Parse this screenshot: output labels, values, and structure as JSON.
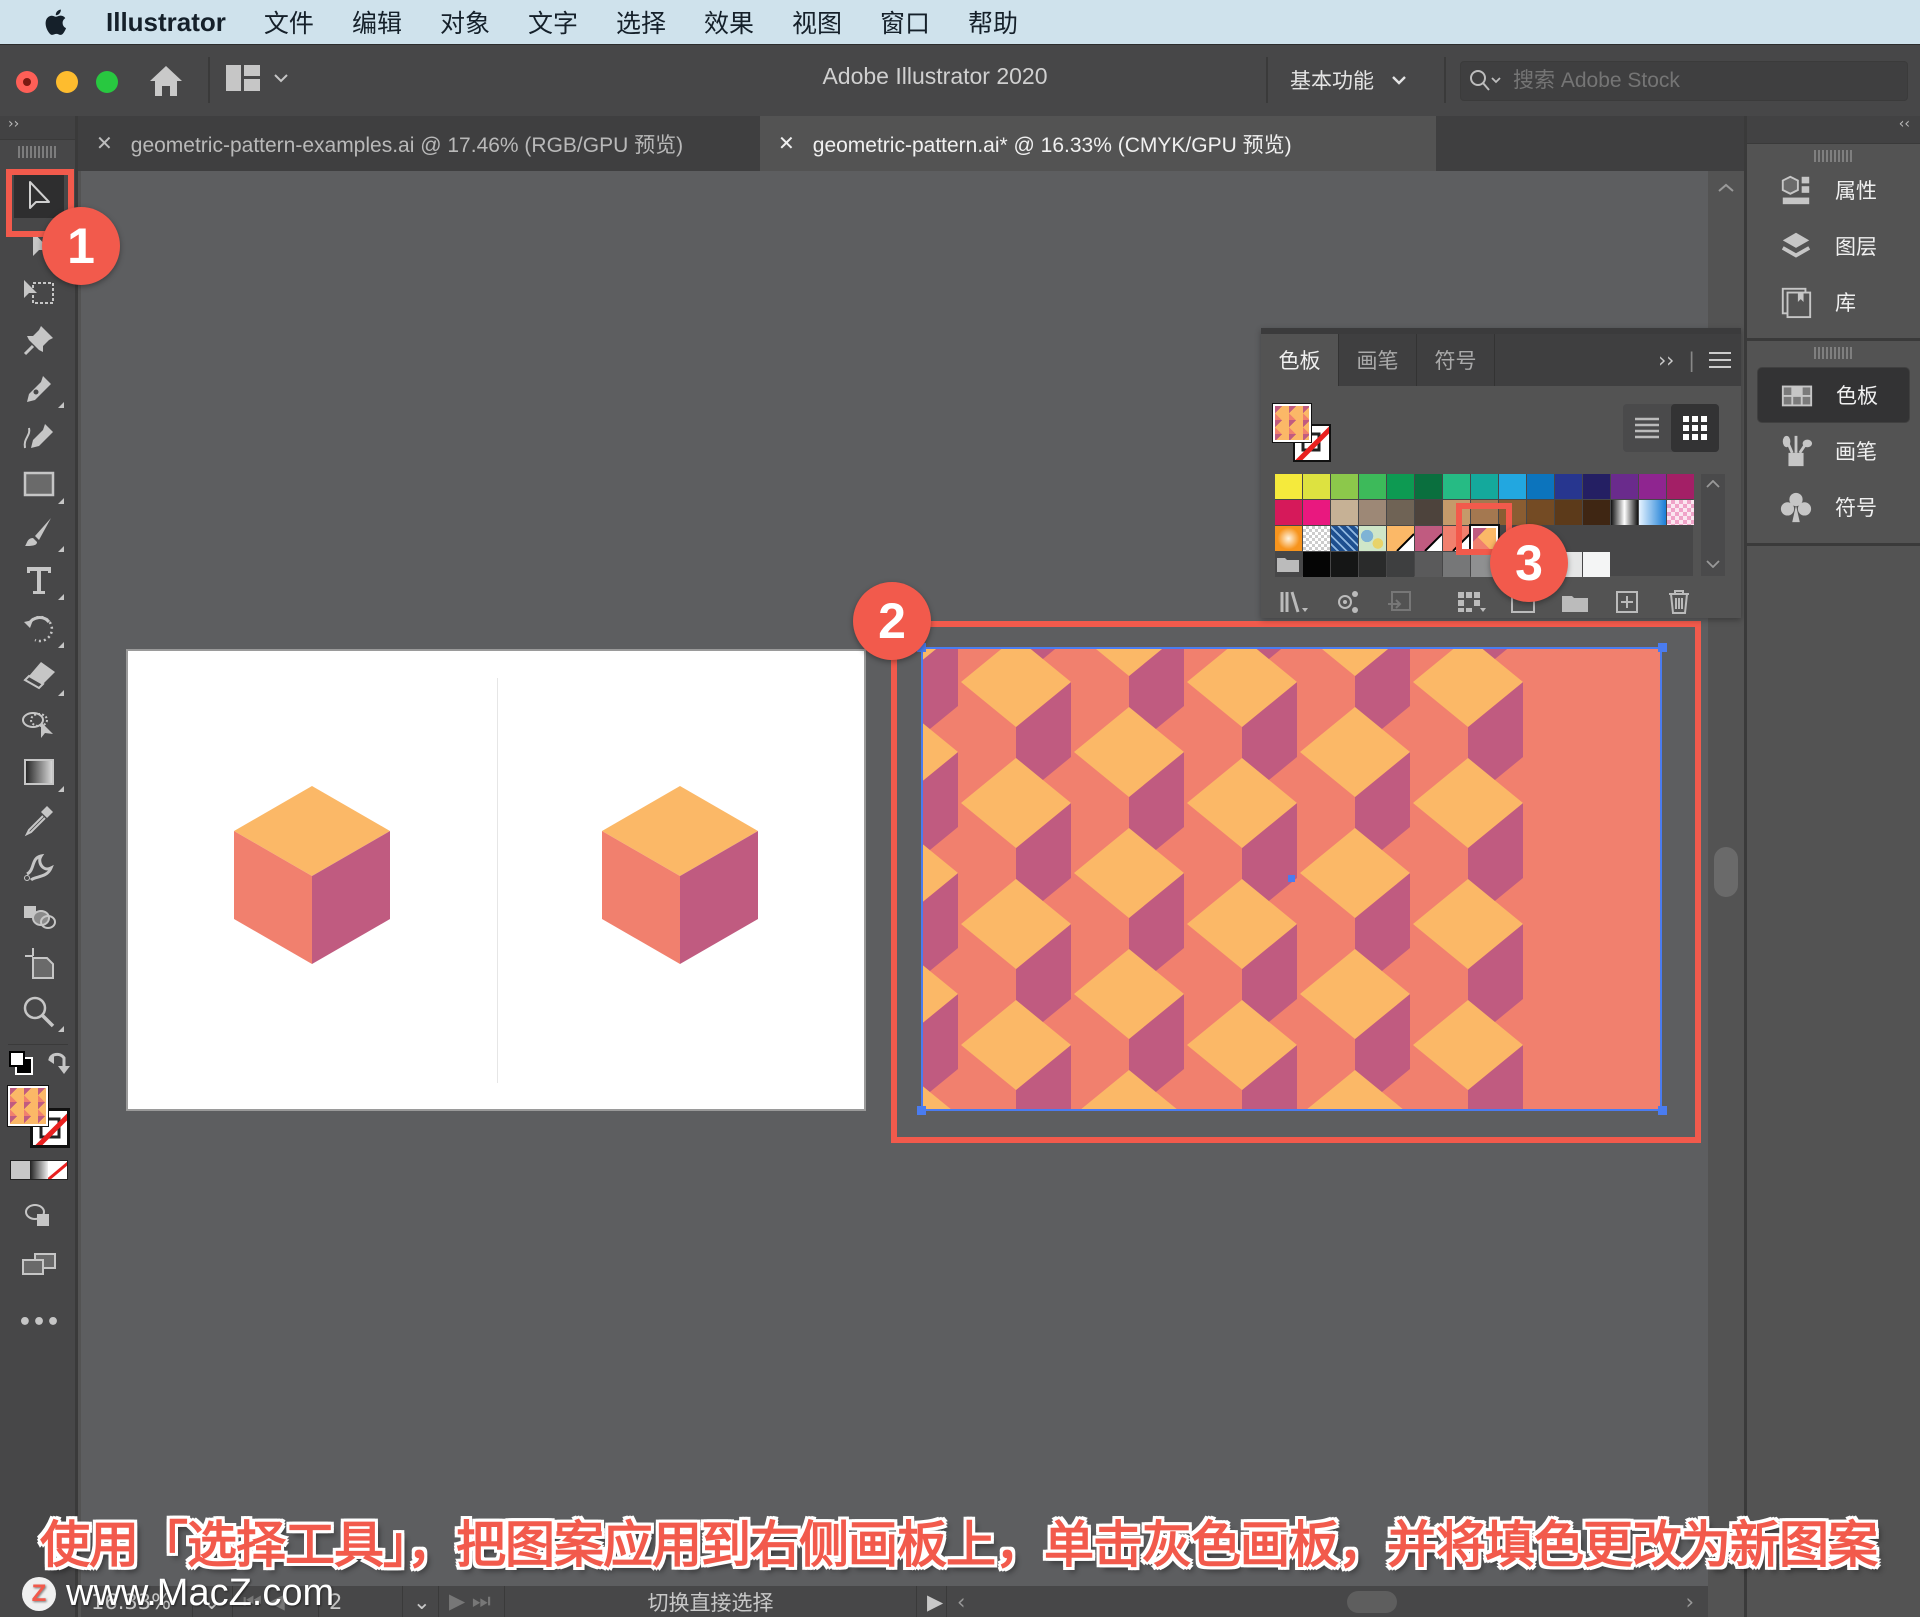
{
  "menubar": {
    "app_name": "Illustrator",
    "items": [
      "文件",
      "编辑",
      "对象",
      "文字",
      "选择",
      "效果",
      "视图",
      "窗口",
      "帮助"
    ]
  },
  "titlebar": {
    "title": "Adobe Illustrator 2020",
    "workspace": "基本功能",
    "search_placeholder": "搜索 Adobe Stock"
  },
  "tabs": [
    {
      "label": "geometric-pattern-examples.ai @ 17.46% (RGB/GPU 预览)",
      "active": false
    },
    {
      "label": "geometric-pattern.ai* @ 16.33% (CMYK/GPU 预览)",
      "active": true
    }
  ],
  "toolbar": {
    "tools": [
      "selection",
      "direct-selection",
      "artboard",
      "puppet-warp",
      "pen",
      "curvature",
      "rectangle",
      "paintbrush",
      "type",
      "rotate",
      "eraser",
      "shape-builder",
      "gradient",
      "eyedropper",
      "blend",
      "live-paint",
      "crop-artboard",
      "zoom"
    ],
    "more_label": "•••"
  },
  "swatches_panel": {
    "tabs": [
      "色板",
      "画笔",
      "符号"
    ],
    "active_tab": "色板",
    "rows": [
      [
        "#f5ea3c",
        "#dde240",
        "#8cc84b",
        "#3dba5a",
        "#0d9a52",
        "#0a6f3e",
        "#26bb84",
        "#14a99c",
        "#22a7e0",
        "#0c74bd",
        "#27368f",
        "#241f63",
        "#6a2b8c",
        "#8f2590",
        "#a31f66"
      ],
      [
        "#d6195a",
        "#e9187f",
        "#c6b195",
        "#9d8876",
        "#6f6355",
        "#4d433c",
        "#c59a6a",
        "#a47850",
        "#8a5d32",
        "#744b24",
        "#5c3a1a",
        "#3f2613",
        "gradient-bw",
        "gradient-blue",
        "pattern-pink"
      ],
      [
        "radial-orange",
        "pattern-checker",
        "pattern-blue",
        "pattern-floral",
        "#fbb867",
        "#c05b80",
        "#f1806e",
        "pattern-cubes"
      ],
      [
        "folder",
        "#050505",
        "#151616",
        "#2a2b2b",
        "#3e3f40",
        "#5a5a5b",
        "#767778",
        "#8f9091",
        "#acadad",
        "#c8c9c9",
        "#e5e6e6",
        "#f4f5f5"
      ]
    ],
    "selected_swatch": "pattern-cubes"
  },
  "dock": {
    "group1": [
      {
        "label": "属性",
        "icon": "properties-icon"
      },
      {
        "label": "图层",
        "icon": "layers-icon"
      },
      {
        "label": "库",
        "icon": "libraries-icon"
      }
    ],
    "group2": [
      {
        "label": "色板",
        "icon": "swatches-icon",
        "active": true
      },
      {
        "label": "画笔",
        "icon": "brushes-icon"
      },
      {
        "label": "符号",
        "icon": "symbols-icon"
      }
    ]
  },
  "artwork": {
    "colors": {
      "top": "#fbb867",
      "left": "#f1806e",
      "right": "#c05b80"
    }
  },
  "callouts": [
    "1",
    "2",
    "3"
  ],
  "caption": "使用「选择工具」，把图案应用到右侧画板上，单击灰色画板，并将填色更改为新图案",
  "statusbar": {
    "zoom": "16.33%",
    "artboard_number": "2",
    "status_text": "切换直接选择"
  },
  "watermark": "www.MacZ.com"
}
